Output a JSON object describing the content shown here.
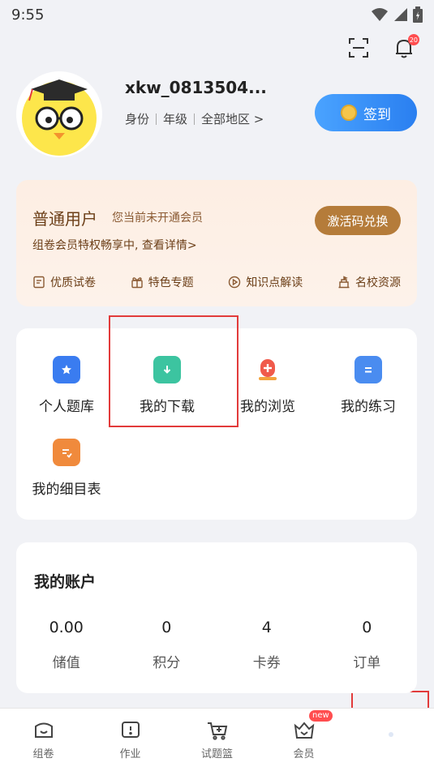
{
  "status_bar": {
    "time": "9:55"
  },
  "header": {
    "notification_count": "20"
  },
  "profile": {
    "username": "xkw_0813504...",
    "identity": "身份",
    "grade": "年级",
    "region": "全部地区 >"
  },
  "checkin": {
    "label": "签到"
  },
  "membership": {
    "level": "普通用户",
    "status": "您当前未开通会员",
    "description": "组卷会员特权畅享中, 查看详情>",
    "redeem_label": "激活码兑换",
    "perks": [
      "优质试卷",
      "特色专题",
      "知识点解读",
      "名校资源"
    ]
  },
  "tools": [
    {
      "label": "个人题库",
      "color": "#3a7cf0"
    },
    {
      "label": "我的下载",
      "color": "#3cc4a0"
    },
    {
      "label": "我的浏览",
      "color": "#f05a4b"
    },
    {
      "label": "我的练习",
      "color": "#4a8cf0"
    },
    {
      "label": "我的细目表",
      "color": "#f08a3c"
    }
  ],
  "account": {
    "title": "我的账户",
    "stats": [
      {
        "value": "0.00",
        "label": "储值"
      },
      {
        "value": "0",
        "label": "积分"
      },
      {
        "value": "4",
        "label": "卡券"
      },
      {
        "value": "0",
        "label": "订单"
      }
    ]
  },
  "tab_bar": {
    "tabs": [
      {
        "label": "组卷"
      },
      {
        "label": "作业"
      },
      {
        "label": "试题篮"
      },
      {
        "label": "会员",
        "badge": "new"
      },
      {
        "label": ""
      }
    ]
  }
}
